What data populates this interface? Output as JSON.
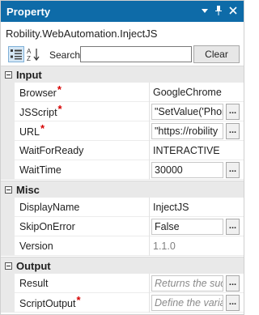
{
  "window": {
    "title": "Property",
    "controls": [
      "dropdown-icon",
      "pin-icon",
      "close-icon"
    ]
  },
  "component_name": "Robility.WebAutomation.InjectJS",
  "toolbar": {
    "categorized_icon": "categorized-icon",
    "alphabetical_icon": "sort-az-icon",
    "search_label": "Search:",
    "search_value": "",
    "clear_label": "Clear"
  },
  "colors": {
    "titlebar": "#0e6ba8",
    "required": "#d60000",
    "category_bg": "#e9e9e9"
  },
  "categories": {
    "input": {
      "label": "Input",
      "rows": [
        {
          "name": "Browser",
          "required": true,
          "value": "GoogleChrome",
          "editable": false
        },
        {
          "name": "JSScript",
          "required": true,
          "value": "\"SetValue('Phon",
          "editable": true
        },
        {
          "name": "URL",
          "required": true,
          "value": "\"https://robility",
          "editable": true
        },
        {
          "name": "WaitForReady",
          "required": false,
          "value": "INTERACTIVE",
          "editable": false
        },
        {
          "name": "WaitTime",
          "required": false,
          "value": "30000",
          "editable": true
        }
      ]
    },
    "misc": {
      "label": "Misc",
      "rows": [
        {
          "name": "DisplayName",
          "required": false,
          "value": "InjectJS",
          "editable": false
        },
        {
          "name": "SkipOnError",
          "required": false,
          "value": "False",
          "editable": true
        },
        {
          "name": "Version",
          "required": false,
          "value": "1.1.0",
          "editable": false
        }
      ]
    },
    "output": {
      "label": "Output",
      "rows": [
        {
          "name": "Result",
          "required": false,
          "placeholder": "Returns the succ",
          "editable": true
        },
        {
          "name": "ScriptOutput",
          "required": true,
          "placeholder": "Define the varia",
          "editable": true
        }
      ]
    }
  },
  "required_marker": "*",
  "ellipsis_label": "..."
}
